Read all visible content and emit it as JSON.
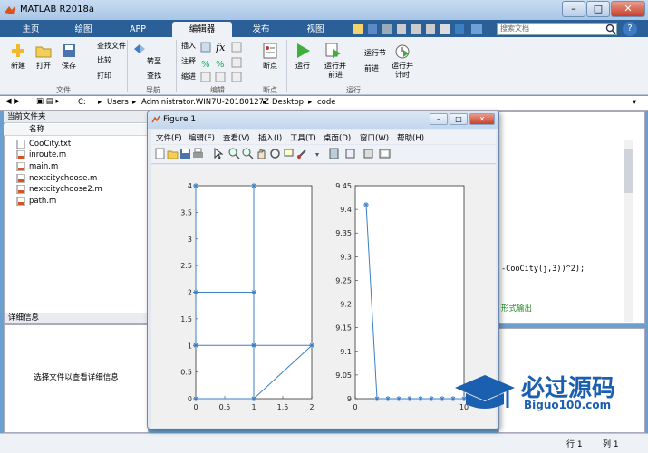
{
  "window": {
    "title": "MATLAB R2018a"
  },
  "ribbon_tabs": [
    "主页",
    "绘图",
    "APP",
    "编辑器",
    "发布",
    "视图"
  ],
  "search": {
    "placeholder": "搜索文档"
  },
  "toolstrip": {
    "file": {
      "new": "新建",
      "open": "打开",
      "save": "保存",
      "find_files": "查找文件",
      "compare": "比较",
      "print": "打印",
      "label": "文件"
    },
    "navigate": {
      "goto": "转至",
      "find": "查找",
      "label": "导航"
    },
    "edit": {
      "insert": "插入",
      "comment": "注释",
      "indent": "缩进",
      "label": "编辑"
    },
    "breakpoints": {
      "bp": "断点",
      "label": "断点"
    },
    "run": {
      "run": "运行",
      "run_advance": "运行并\n前进",
      "run_section": "运行节",
      "advance": "前进",
      "run_time": "运行并\n计时",
      "label": "运行"
    }
  },
  "pathbar": {
    "parts": [
      "C:",
      "Users",
      "Administrator.WIN7U-20180127Z",
      "Desktop",
      "code"
    ]
  },
  "current_folder": {
    "title": "当前文件夹",
    "column": "名称",
    "files": [
      "CooCity.txt",
      "inroute.m",
      "main.m",
      "nextcitychoose.m",
      "nextcitychoose2.m",
      "path.m"
    ]
  },
  "details": {
    "title": "详细信息",
    "message": "选择文件以查看详细信息"
  },
  "editor": {
    "line1": "-CooCity(j,3))^2);",
    "line2": "形式输出"
  },
  "status": {
    "line_label": "行",
    "line": "1",
    "col_label": "列",
    "col": "1"
  },
  "figure": {
    "title": "Figure 1",
    "menus": [
      "文件(F)",
      "编辑(E)",
      "查看(V)",
      "插入(I)",
      "工具(T)",
      "桌面(D)",
      "窗口(W)",
      "帮助(H)"
    ]
  },
  "watermark": {
    "line1": "必过源码",
    "line2": "Biguo100.com"
  },
  "chart_data": [
    {
      "type": "line",
      "x": [
        0,
        1,
        1,
        0,
        0,
        1,
        1,
        1,
        2,
        1,
        0,
        0
      ],
      "y": [
        0,
        0,
        1,
        1,
        2,
        2,
        4,
        0,
        1,
        1,
        1,
        4
      ],
      "xlim": [
        0,
        2
      ],
      "ylim": [
        0,
        4
      ],
      "xticks": [
        "0",
        "0.5",
        "1",
        "1.5",
        "2"
      ],
      "yticks": [
        "0",
        "0.5",
        "1",
        "1.5",
        "2",
        "2.5",
        "3",
        "3.5",
        "4"
      ],
      "color": "#3b7fc4",
      "marker": "*"
    },
    {
      "type": "line",
      "x": [
        1,
        2,
        3,
        4,
        5,
        6,
        7,
        8,
        9,
        10
      ],
      "y": [
        9.41,
        9,
        9,
        9,
        9,
        9,
        9,
        9,
        9,
        9
      ],
      "xlim": [
        0,
        10
      ],
      "ylim": [
        9,
        9.45
      ],
      "xticks": [
        "0",
        "10"
      ],
      "yticks": [
        "9",
        "9.05",
        "9.1",
        "9.15",
        "9.2",
        "9.25",
        "9.3",
        "9.35",
        "9.4",
        "9.45"
      ],
      "color": "#3b7fc4",
      "marker": "*"
    }
  ]
}
